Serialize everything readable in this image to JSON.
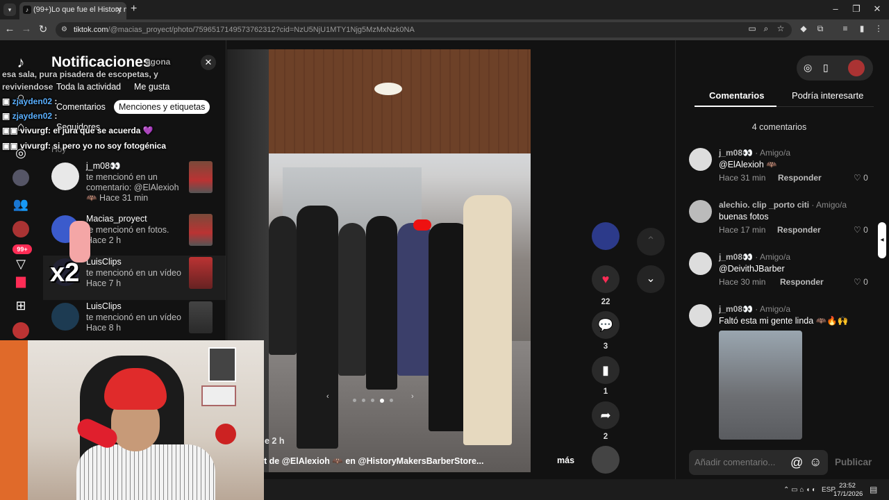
{
  "browser": {
    "tab_title": "(99+)Lo que fue el History mei",
    "url_host": "tiktok.com",
    "url_path": "/@macias_proyect/photo/7596517149573762312?cid=NzU5NjU1MTY1Njg5MzMxNzk0NA",
    "lang": "ESP",
    "time": "23:52",
    "date": "17/1/2026"
  },
  "nav": {
    "badge": "99+"
  },
  "notifications": {
    "title": "Notificaciones",
    "filters": [
      "Toda la actividad",
      "Me gusta",
      "Comentarios",
      "Menciones y etiquetas",
      "Seguidores"
    ],
    "active_filter": "Menciones y etiquetas",
    "section": "Hoy",
    "items": [
      {
        "name": "j_m08👀",
        "text": "te mencionó en un comentario: @ElAlexioh 🦇 Hace 31 min"
      },
      {
        "name": "Macias_proyect",
        "text": "te mencionó en fotos. Hace 2 h"
      },
      {
        "name": "LuisClips",
        "text": "te mencionó en un vídeo Hace 7 h"
      },
      {
        "name": "LuisClips",
        "text": "te mencionó en un vídeo Hace 8 h"
      }
    ]
  },
  "chat": {
    "lines": [
      {
        "user": "",
        "text": "agona"
      },
      {
        "user": "",
        "text": "esa sala, pura pisadera de escopetas, y"
      },
      {
        "user": "",
        "text": "reviviendose"
      },
      {
        "user": "zjayden02",
        "text": ":"
      },
      {
        "user": "zjayden02",
        "text": ":"
      },
      {
        "user": "vivurgf",
        "text": ": el jura que se acuerda 💜"
      },
      {
        "user": "vivurgf",
        "text": ": si pero yo no soy fotogénica"
      }
    ],
    "sticker_text": "x2"
  },
  "post": {
    "time": "e 2 h",
    "caption": "t de @ElAlexioh 🦇 en @HistoryMakersBarberStore...",
    "more": "más",
    "likes": "22",
    "comments": "3",
    "saves": "1",
    "shares": "2"
  },
  "comments_panel": {
    "tabs": [
      "Comentarios",
      "Podría interesarte"
    ],
    "count": "4 comentarios",
    "reply_label": "Responder",
    "items": [
      {
        "user": "j_m08👀",
        "rel": " · Amigo/a",
        "text": "@ElAlexioh 🦇",
        "time": "Hace 31 min",
        "likes": "0"
      },
      {
        "user": "alechio. clip _porto citi",
        "rel": " · Amigo/a",
        "text": "buenas fotos",
        "time": "Hace 17 min",
        "likes": "0"
      },
      {
        "user": "j_m08👀",
        "rel": " · Amigo/a",
        "text": "@DeivithJBarber",
        "time": "Hace 30 min",
        "likes": "0"
      },
      {
        "user": "j_m08👀",
        "rel": " · Amigo/a",
        "text": "Faltó esta mi gente linda 🦇🔥🙌",
        "time": "",
        "likes": ""
      }
    ],
    "input_placeholder": "Añadir comentario...",
    "publish": "Publicar"
  }
}
